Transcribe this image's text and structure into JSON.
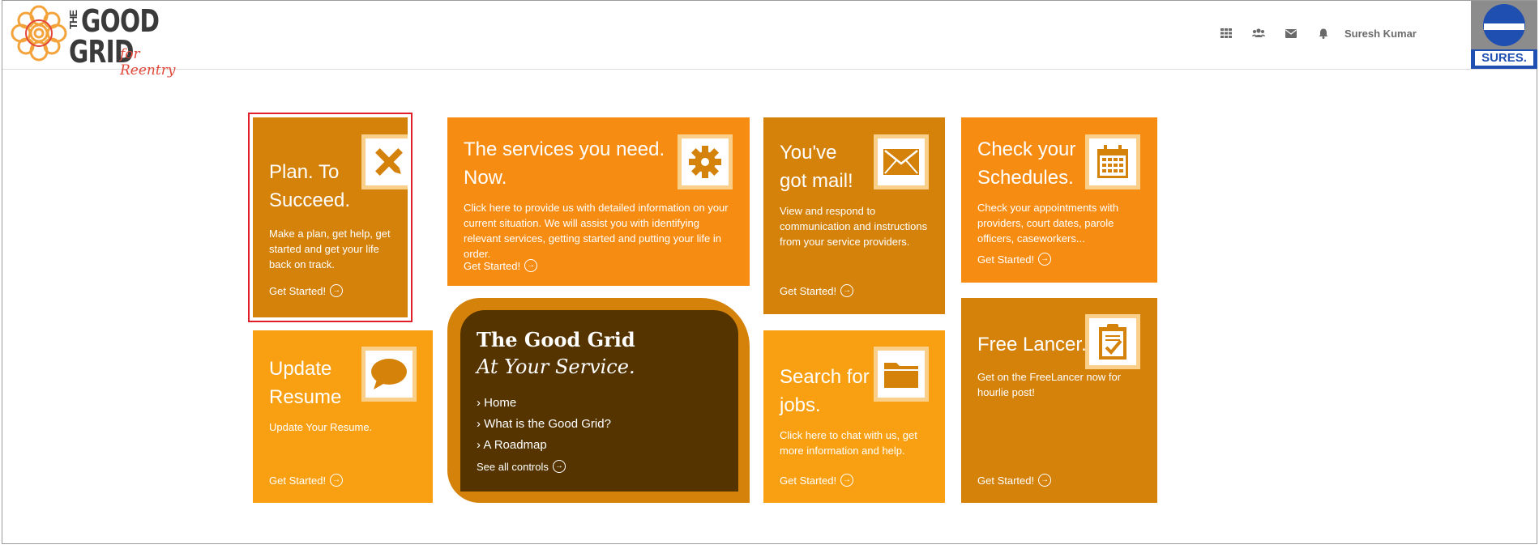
{
  "header": {
    "logo": {
      "the": "THE",
      "good": "GOOD",
      "grid": "GRID",
      "tagline": "for Reentry"
    },
    "nav_icons": [
      "apps-grid-icon",
      "users-icon",
      "mail-icon",
      "bell-icon"
    ],
    "user_name": "Suresh Kumar",
    "avatar_label": "SURES."
  },
  "tiles": {
    "plan": {
      "title_l1": "Plan. To",
      "title_l2": "Succeed.",
      "desc": "Make a plan, get help, get started and get your life back on track.",
      "cta": "Get Started!"
    },
    "services": {
      "title_l1": "The services you need.",
      "title_l2": "Now.",
      "desc": "Click here to provide us with detailed information on your current situation. We will assist you with identifying relevant services, getting started and putting your life in order.",
      "cta": "Get Started!"
    },
    "mail": {
      "title_l1": "You've",
      "title_l2": "got mail!",
      "desc": "View and respond to communication and instructions from your service providers.",
      "cta": "Get Started!"
    },
    "schedules": {
      "title_l1": "Check your",
      "title_l2": "Schedules.",
      "desc": "Check your appointments with providers, court dates, parole officers, caseworkers...",
      "cta": "Get Started!"
    },
    "resume": {
      "title_l1": "Update",
      "title_l2": "Resume",
      "desc": "Update Your Resume.",
      "cta": "Get Started!"
    },
    "jobs": {
      "title_l1": "Search for",
      "title_l2": "jobs.",
      "desc": "Click here to chat with us, get more information and help.",
      "cta": "Get Started!"
    },
    "freelancer": {
      "title_l1": "Free Lancer.",
      "desc": "Get on the FreeLancer now for hourlie post!",
      "cta": "Get Started!"
    }
  },
  "service_panel": {
    "title": "The Good Grid",
    "subtitle": "At Your Service.",
    "links": [
      "Home",
      "What is the Good Grid?",
      "A Roadmap"
    ],
    "see_all": "See all controls"
  },
  "colors": {
    "dark_orange": "#d4820a",
    "orange": "#f68c12",
    "light_orange": "#f8a012",
    "brown": "#553400",
    "highlight": "#e01f2b"
  }
}
